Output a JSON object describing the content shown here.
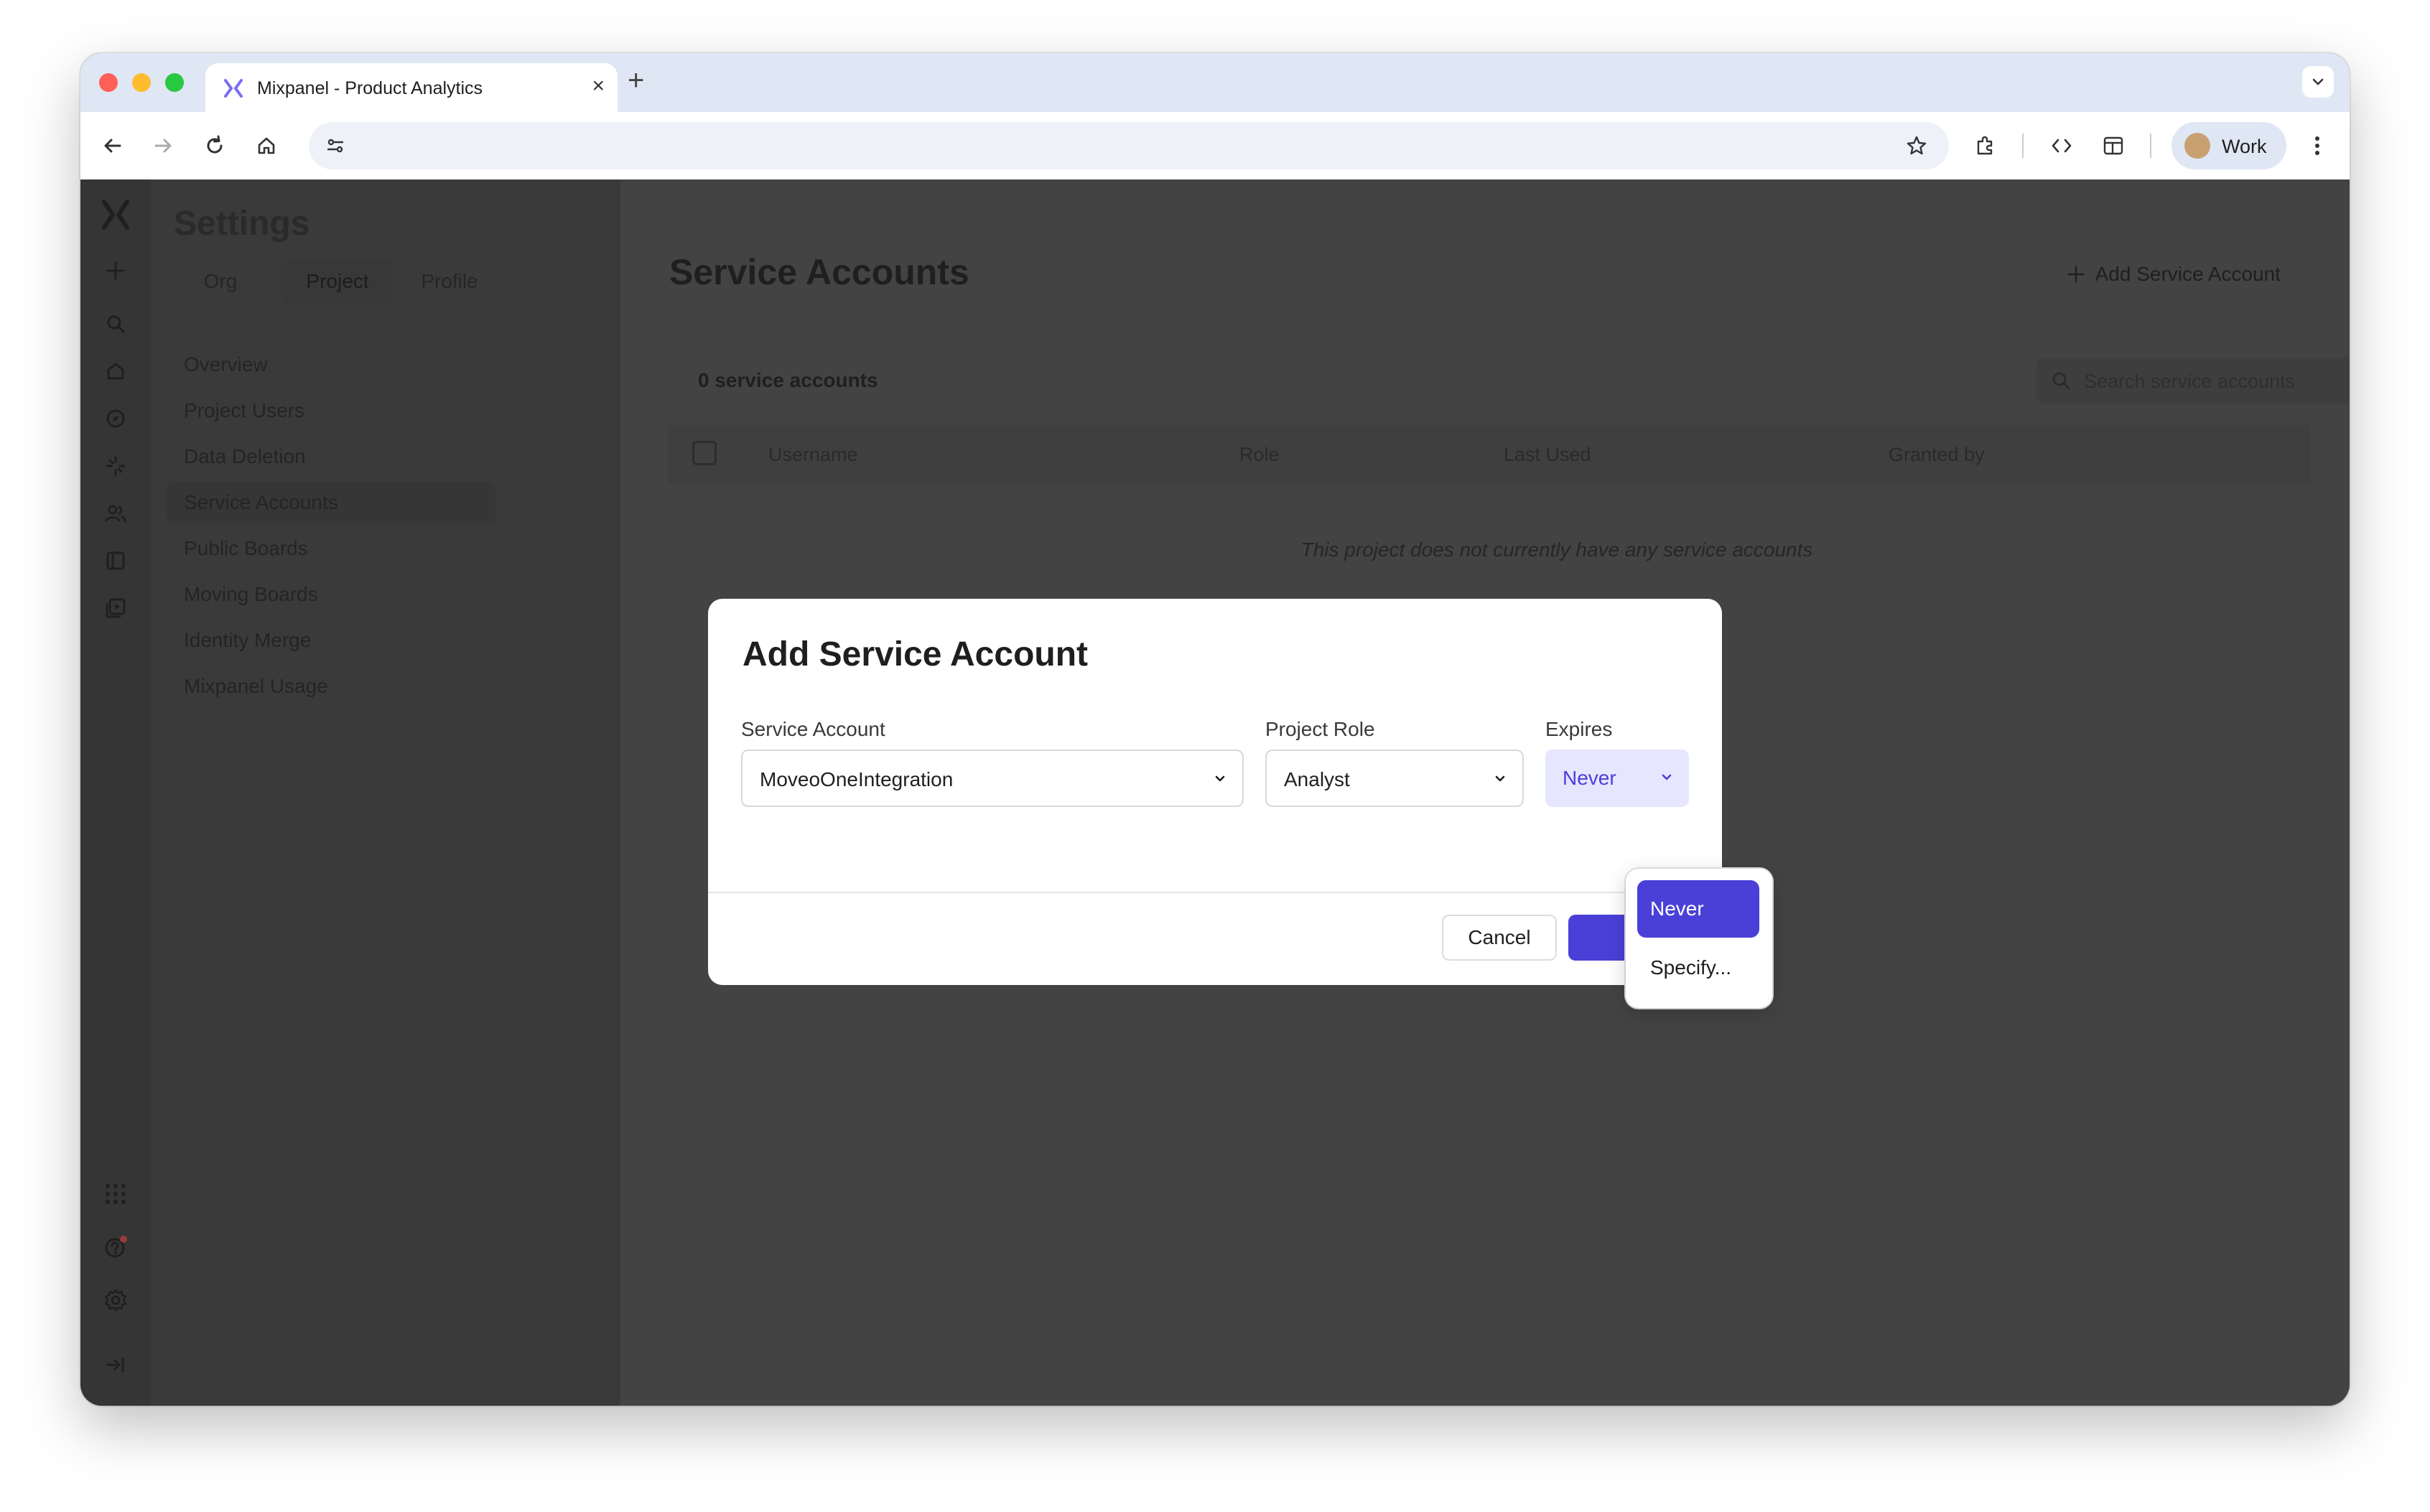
{
  "browser": {
    "tab_title": "Mixpanel - Product Analytics",
    "profile_label": "Work"
  },
  "settings": {
    "title": "Settings",
    "scope_tabs": [
      {
        "label": "Org"
      },
      {
        "label": "Project",
        "active": true
      },
      {
        "label": "Profile"
      }
    ],
    "nav_items": [
      {
        "label": "Overview"
      },
      {
        "label": "Project Users"
      },
      {
        "label": "Data Deletion"
      },
      {
        "label": "Service Accounts",
        "active": true
      },
      {
        "label": "Public Boards"
      },
      {
        "label": "Moving Boards"
      },
      {
        "label": "Identity Merge"
      },
      {
        "label": "Mixpanel Usage"
      }
    ]
  },
  "main": {
    "title": "Service Accounts",
    "add_label": "Add Service Account",
    "count_label": "0 service accounts",
    "search_placeholder": "Search service accounts",
    "columns": [
      "Username",
      "Role",
      "Last Used",
      "Granted by"
    ],
    "empty_message": "This project does not currently have any service accounts"
  },
  "modal": {
    "title": "Add Service Account",
    "service_account_label": "Service Account",
    "service_account_value": "MoveoOneIntegration",
    "project_role_label": "Project Role",
    "project_role_value": "Analyst",
    "expires_label": "Expires",
    "expires_value": "Never",
    "expires_options": [
      "Never",
      "Specify..."
    ],
    "cancel_label": "Cancel"
  },
  "colors": {
    "accent": "#4a40d8",
    "overlay": "#434343",
    "expires_bg": "#e6e6ff"
  }
}
